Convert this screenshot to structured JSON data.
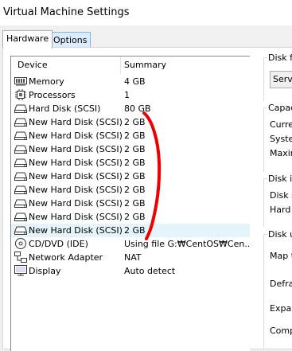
{
  "window": {
    "title": "Virtual Machine Settings"
  },
  "tabs": [
    {
      "label": "Hardware",
      "active": true
    },
    {
      "label": "Options",
      "active": false
    }
  ],
  "device_list": {
    "headers": {
      "device": "Device",
      "summary": "Summary"
    },
    "rows": [
      {
        "icon": "memory-icon",
        "device": "Memory",
        "summary": "4 GB"
      },
      {
        "icon": "processor-icon",
        "device": "Processors",
        "summary": "1"
      },
      {
        "icon": "hard-disk-icon",
        "device": "Hard Disk (SCSI)",
        "summary": "80 GB"
      },
      {
        "icon": "hard-disk-icon",
        "device": "New Hard Disk (SCSI)",
        "summary": "2 GB"
      },
      {
        "icon": "hard-disk-icon",
        "device": "New Hard Disk (SCSI)",
        "summary": "2 GB"
      },
      {
        "icon": "hard-disk-icon",
        "device": "New Hard Disk (SCSI)",
        "summary": "2 GB"
      },
      {
        "icon": "hard-disk-icon",
        "device": "New Hard Disk (SCSI)",
        "summary": "2 GB"
      },
      {
        "icon": "hard-disk-icon",
        "device": "New Hard Disk (SCSI)",
        "summary": "2 GB"
      },
      {
        "icon": "hard-disk-icon",
        "device": "New Hard Disk (SCSI)",
        "summary": "2 GB"
      },
      {
        "icon": "hard-disk-icon",
        "device": "New Hard Disk (SCSI)",
        "summary": "2 GB"
      },
      {
        "icon": "hard-disk-icon",
        "device": "New Hard Disk (SCSI)",
        "summary": "2 GB"
      },
      {
        "icon": "hard-disk-icon",
        "device": "New Hard Disk (SCSI)",
        "summary": "2 GB",
        "selected": true
      },
      {
        "icon": "cd-dvd-icon",
        "device": "CD/DVD (IDE)",
        "summary": "Using file G:₩CentOS₩Cen..."
      },
      {
        "icon": "network-adapter-icon",
        "device": "Network Adapter",
        "summary": "NAT"
      },
      {
        "icon": "display-icon",
        "device": "Display",
        "summary": "Auto detect"
      }
    ]
  },
  "right_panel": {
    "disk_file": {
      "title": "Disk fil",
      "value": "Serve"
    },
    "capacity": {
      "title": "Capaci",
      "lines": [
        "Curren",
        "Systen",
        "Maxim"
      ]
    },
    "disk_info": {
      "title": "Disk inf",
      "lines": [
        "Disk sp",
        "Hard d"
      ]
    },
    "disk_utilities": {
      "title": "Disk ut",
      "lines": [
        "Map th",
        "Defrag",
        "Expan",
        "Compa"
      ]
    }
  },
  "colors": {
    "annotation": "#ee0000",
    "selection": "#e5f3fb",
    "tab_inactive": "#dcecfc"
  }
}
